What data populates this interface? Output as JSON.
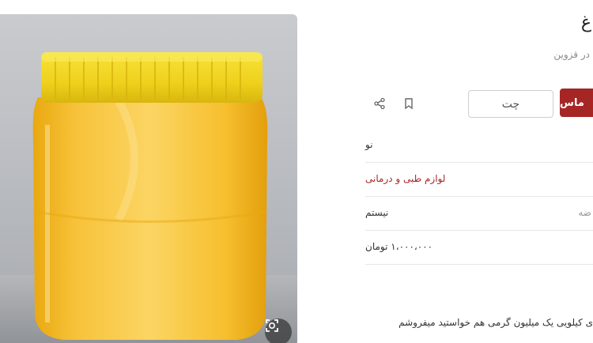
{
  "listing": {
    "title_fragment": "غ",
    "location": "در قزوین",
    "photo": {
      "alt": "yellow-ghee-jar"
    }
  },
  "actions": {
    "contact_label": "ماس",
    "chat_label": "چت",
    "bookmark_icon": "bookmark-icon",
    "share_icon": "share-icon",
    "zoom_icon": "zoom-icon"
  },
  "details": [
    {
      "label": "",
      "value": "نو"
    },
    {
      "label": "",
      "value": "لوازم طبی و درمانی"
    },
    {
      "label": "ضه",
      "value": "نیستم"
    },
    {
      "label": "",
      "value": "۱،۰۰۰،۰۰۰ تومان"
    }
  ],
  "description": {
    "line1": "ی کیلویی یک میلیون گرمی هم خواستید میفروشم"
  },
  "colors": {
    "accent": "#a62626",
    "jar_yellow": "#f4c11f",
    "lid_yellow": "#f2d21a"
  }
}
